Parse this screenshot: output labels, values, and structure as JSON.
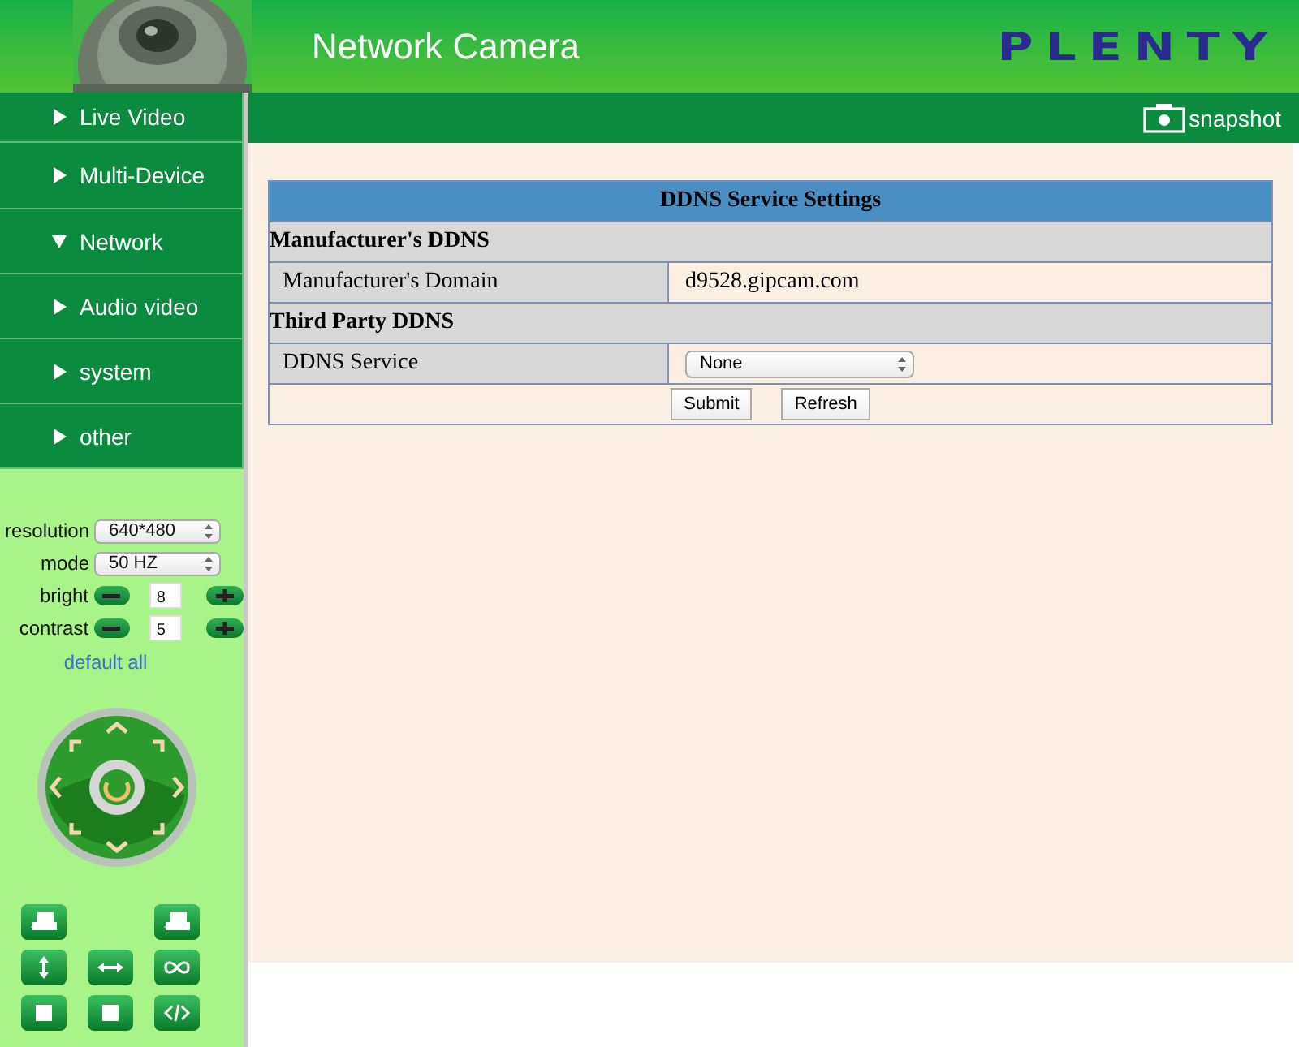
{
  "header": {
    "title": "Network Camera",
    "logo": "PLENTY"
  },
  "menu": [
    {
      "label": "Live Video",
      "expanded": false
    },
    {
      "label": "Multi-Device",
      "expanded": false
    },
    {
      "label": "Network",
      "expanded": true
    },
    {
      "label": "Audio video",
      "expanded": false
    },
    {
      "label": "system",
      "expanded": false
    },
    {
      "label": "other",
      "expanded": false
    }
  ],
  "toolbar": {
    "snapshot": "snapshot"
  },
  "image_settings": {
    "selects": [
      {
        "label": "resolution",
        "value": "640*480"
      },
      {
        "label": "mode",
        "value": "50 HZ"
      }
    ],
    "steppers": [
      {
        "label": "bright",
        "value": "8"
      },
      {
        "label": "contrast",
        "value": "5"
      }
    ],
    "reset_link": "default all"
  },
  "panel": {
    "title": "DDNS Service Settings",
    "sections": [
      {
        "heading": "Manufacturer's DDNS",
        "rows": [
          {
            "label": "Manufacturer's Domain",
            "kind": "text",
            "value": "d9528.gipcam.com"
          }
        ]
      },
      {
        "heading": "Third Party DDNS",
        "rows": [
          {
            "label": "DDNS Service",
            "kind": "select",
            "value": "None"
          }
        ]
      }
    ],
    "buttons": [
      "Submit",
      "Refresh"
    ]
  }
}
